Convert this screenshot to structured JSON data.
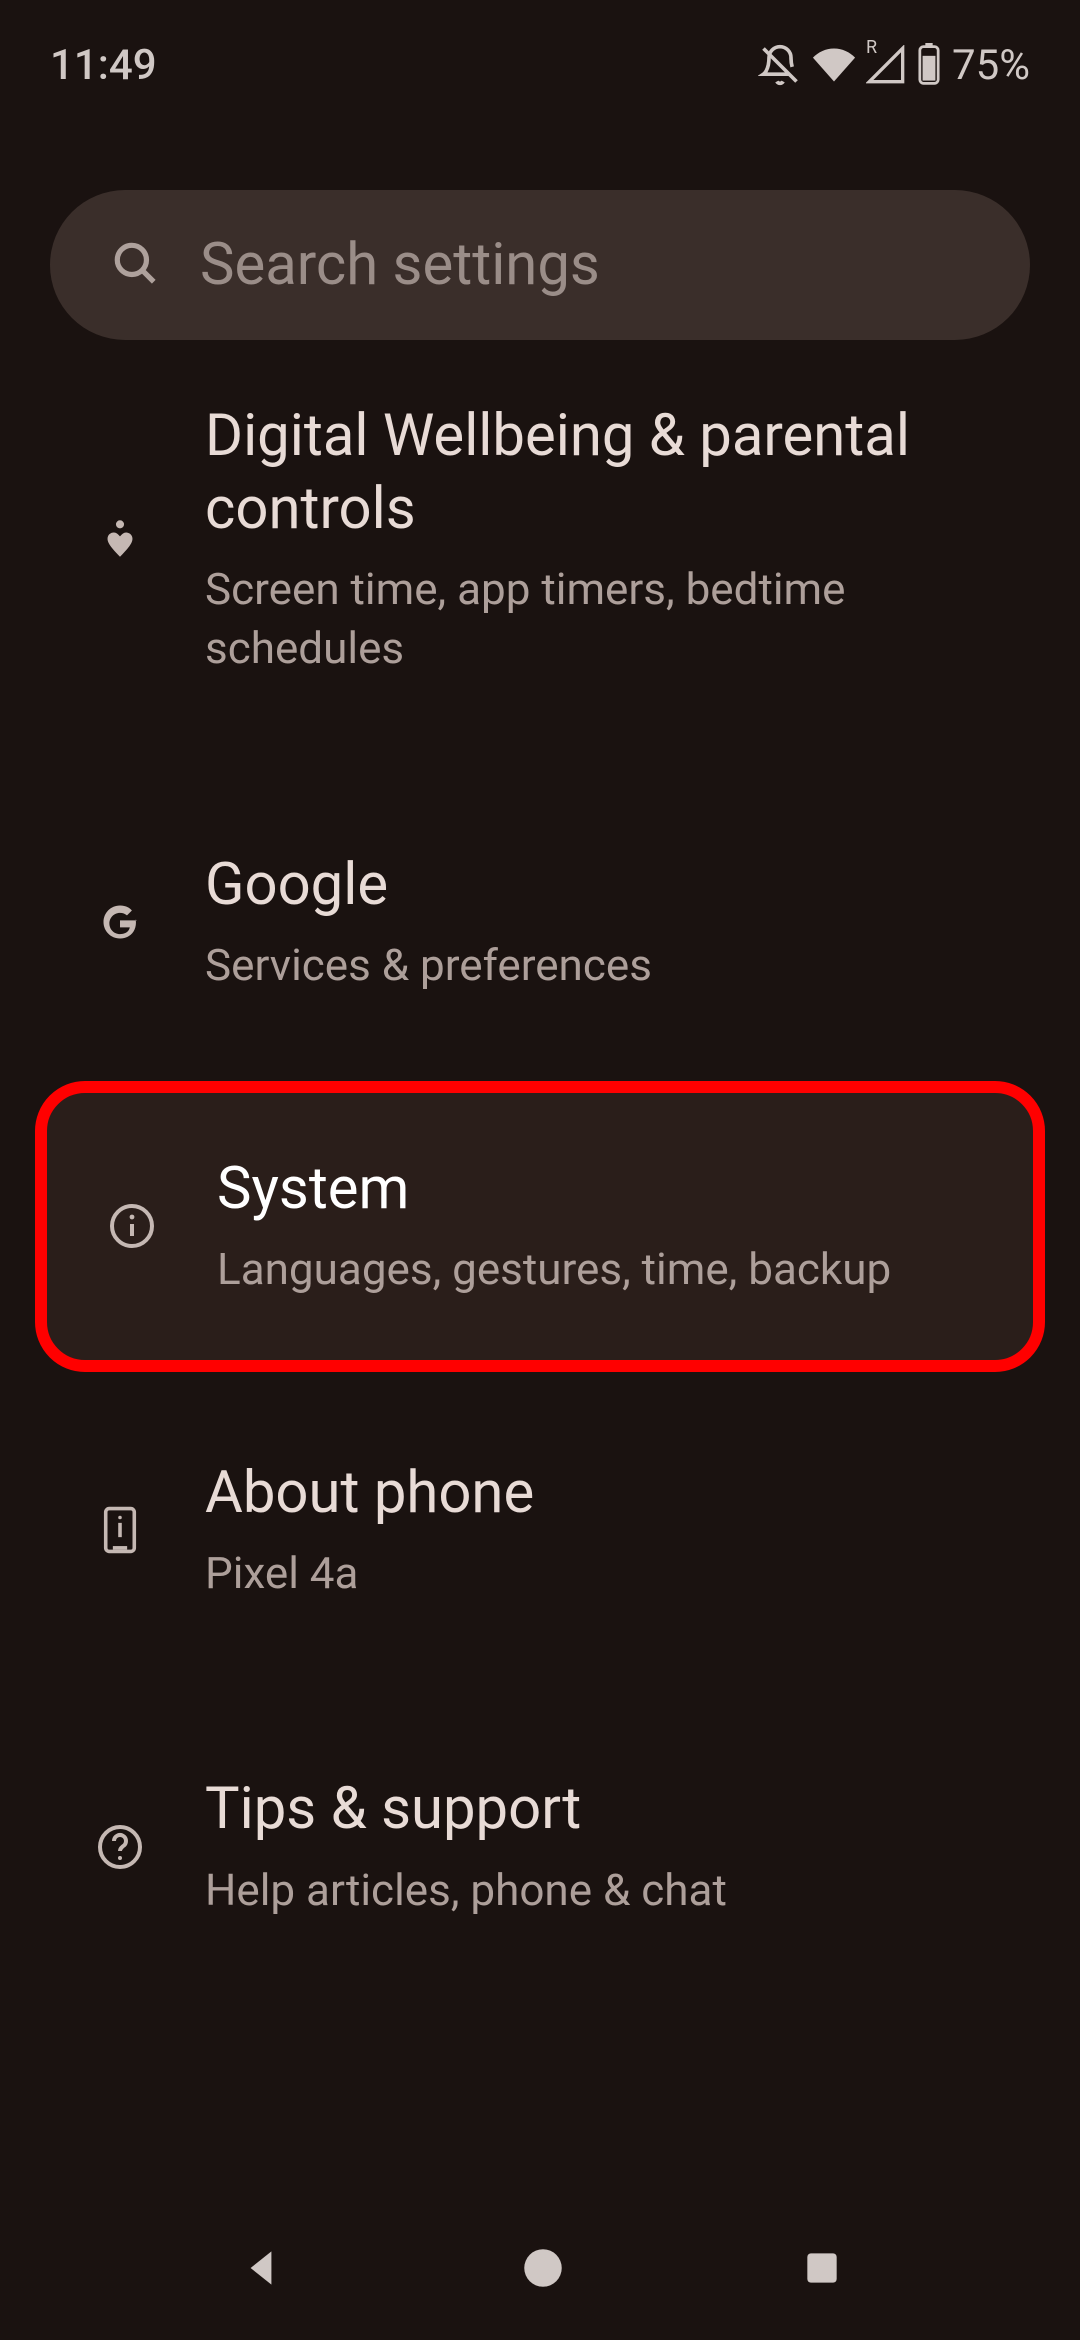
{
  "status": {
    "time": "11:49",
    "battery": "75%",
    "roaming": "R"
  },
  "search": {
    "placeholder": "Search settings"
  },
  "items": [
    {
      "title": "Digital Wellbeing & parental controls",
      "subtitle": "Screen time, app timers, bedtime schedules"
    },
    {
      "title": "Google",
      "subtitle": "Services & preferences"
    },
    {
      "title": "System",
      "subtitle": "Languages, gestures, time, backup"
    },
    {
      "title": "About phone",
      "subtitle": "Pixel 4a"
    },
    {
      "title": "Tips & support",
      "subtitle": "Help articles, phone & chat"
    }
  ]
}
